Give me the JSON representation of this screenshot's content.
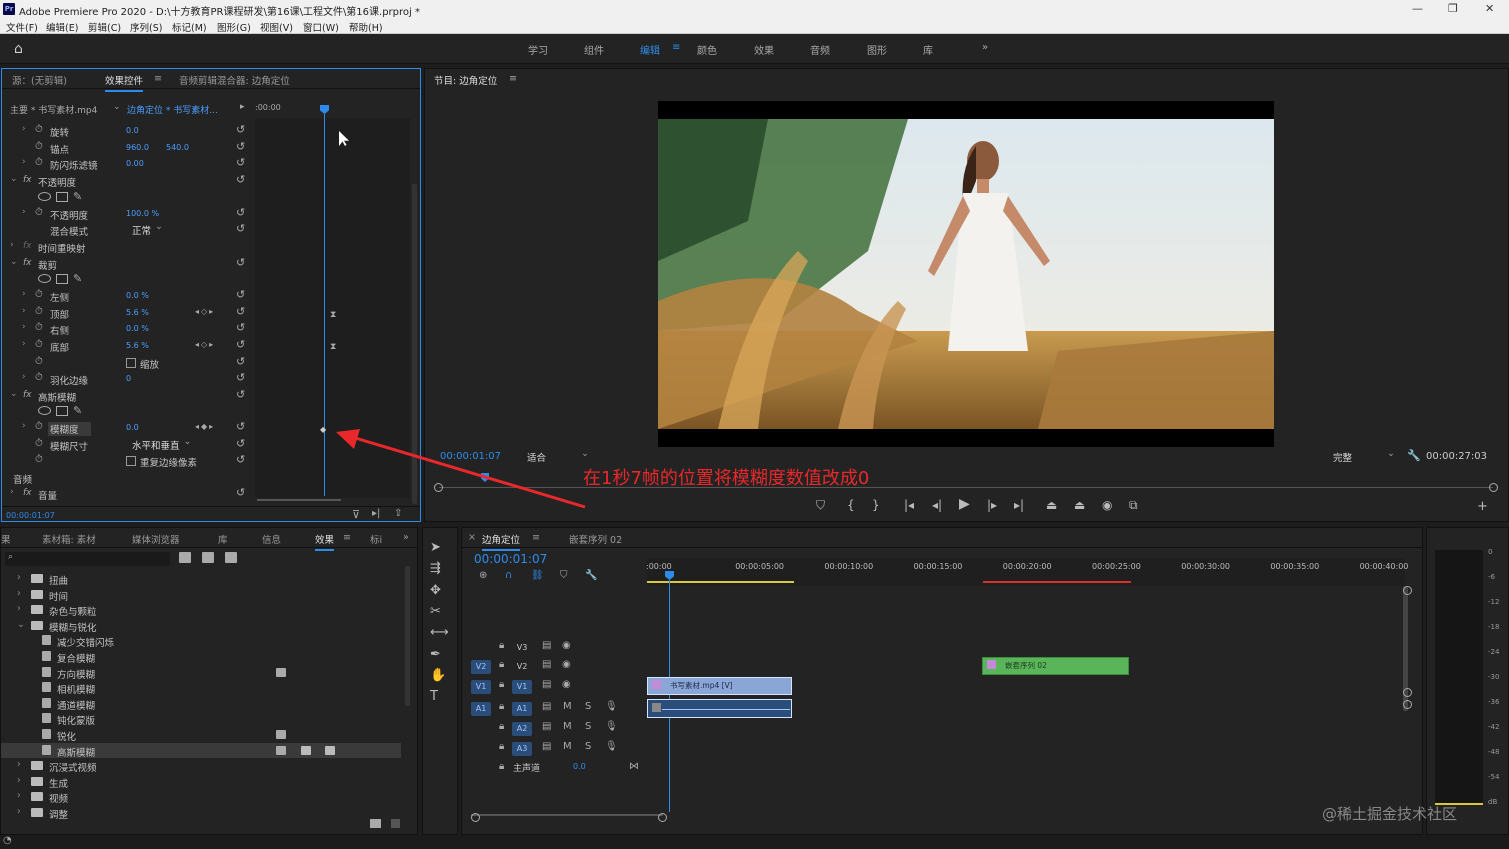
{
  "titlebar": {
    "title": "Adobe Premiere Pro 2020 - D:\\十方教育PR课程研发\\第16课\\工程文件\\第16课.prproj *",
    "app_icon": "Pr"
  },
  "menu": [
    "文件(F)",
    "编辑(E)",
    "剪辑(C)",
    "序列(S)",
    "标记(M)",
    "图形(G)",
    "视图(V)",
    "窗口(W)",
    "帮助(H)"
  ],
  "workspaces": [
    "学习",
    "组件",
    "编辑",
    "颜色",
    "效果",
    "音频",
    "图形",
    "库"
  ],
  "active_workspace": "编辑",
  "effect_panel": {
    "tabs": [
      "源：(无剪辑)",
      "效果控件",
      "音频剪辑混合器: 边角定位"
    ],
    "clip_master": "主要 * 书写素材.mp4",
    "clip_seq": "边角定位 * 书写素材...",
    "time_start": ":00:00",
    "rows": {
      "rotate": {
        "label": "旋转",
        "value": "0.0"
      },
      "anchor": {
        "label": "锚点",
        "value": "960.0",
        "value2": "540.0"
      },
      "flicker": {
        "label": "防闪烁滤镜",
        "value": "0.00"
      },
      "opacity_sec": {
        "label": "不透明度"
      },
      "opacity": {
        "label": "不透明度",
        "value": "100.0 %"
      },
      "blend": {
        "label": "混合模式",
        "value": "正常"
      },
      "timeremap": {
        "label": "时间重映射"
      },
      "crop_sec": {
        "label": "裁剪"
      },
      "left": {
        "label": "左侧",
        "value": "0.0 %"
      },
      "top": {
        "label": "顶部",
        "value": "5.6 %"
      },
      "right": {
        "label": "右侧",
        "value": "0.0 %"
      },
      "bottom": {
        "label": "底部",
        "value": "5.6 %"
      },
      "zoom": {
        "label": "缩放"
      },
      "feather": {
        "label": "羽化边缘",
        "value": "0"
      },
      "gauss_sec": {
        "label": "高斯模糊"
      },
      "blurriness": {
        "label": "模糊度",
        "value": "0.0"
      },
      "blurdim": {
        "label": "模糊尺寸",
        "value": "水平和垂直"
      },
      "repeat": {
        "label": "重复边缘像素"
      },
      "audio": {
        "label": "音频"
      },
      "volume": {
        "label": "音量"
      }
    },
    "timecode": "00:00:01:07"
  },
  "program": {
    "title": "节目: 边角定位",
    "timecode": "00:00:01:07",
    "fit": "适合",
    "quality": "完整",
    "duration": "00:00:27:03"
  },
  "annotation": "在1秒7帧的位置将模糊度数值改成0",
  "effects_panel": {
    "tabs": [
      "素材箱: 素材",
      "媒体浏览器",
      "库",
      "信息",
      "效果",
      "标i"
    ],
    "folders": [
      {
        "name": "扭曲",
        "type": "folder"
      },
      {
        "name": "时间",
        "type": "folder"
      },
      {
        "name": "杂色与颗粒",
        "type": "folder"
      },
      {
        "name": "模糊与锐化",
        "type": "folder",
        "open": true
      },
      {
        "name": "减少交错闪烁",
        "type": "effect"
      },
      {
        "name": "复合模糊",
        "type": "effect"
      },
      {
        "name": "方向模糊",
        "type": "effect"
      },
      {
        "name": "相机模糊",
        "type": "effect"
      },
      {
        "name": "通道模糊",
        "type": "effect"
      },
      {
        "name": "钝化蒙版",
        "type": "effect"
      },
      {
        "name": "锐化",
        "type": "effect"
      },
      {
        "name": "高斯模糊",
        "type": "effect",
        "selected": true
      },
      {
        "name": "沉浸式视频",
        "type": "folder"
      },
      {
        "name": "生成",
        "type": "folder"
      },
      {
        "name": "视频",
        "type": "folder"
      },
      {
        "name": "调整",
        "type": "folder"
      }
    ]
  },
  "timeline": {
    "tabs": [
      "边角定位",
      "嵌套序列 02"
    ],
    "timecode": "00:00:01:07",
    "ruler": [
      ":00:00",
      "00:00:05:00",
      "00:00:10:00",
      "00:00:15:00",
      "00:00:20:00",
      "00:00:25:00",
      "00:00:30:00",
      "00:00:35:00",
      "00:00:40:00"
    ],
    "tracks": [
      "V3",
      "V2",
      "V1",
      "A1",
      "A2",
      "A3"
    ],
    "master": {
      "label": "主声道",
      "value": "0.0"
    },
    "clips": {
      "v1": "书写素材.mp4 [V]",
      "v2": "嵌套序列 02"
    }
  },
  "meter_ticks": [
    "0",
    "-6",
    "-12",
    "-18",
    "-24",
    "-30",
    "-36",
    "-42",
    "-48",
    "-54",
    "dB"
  ],
  "watermark": "@稀土掘金技术社区"
}
